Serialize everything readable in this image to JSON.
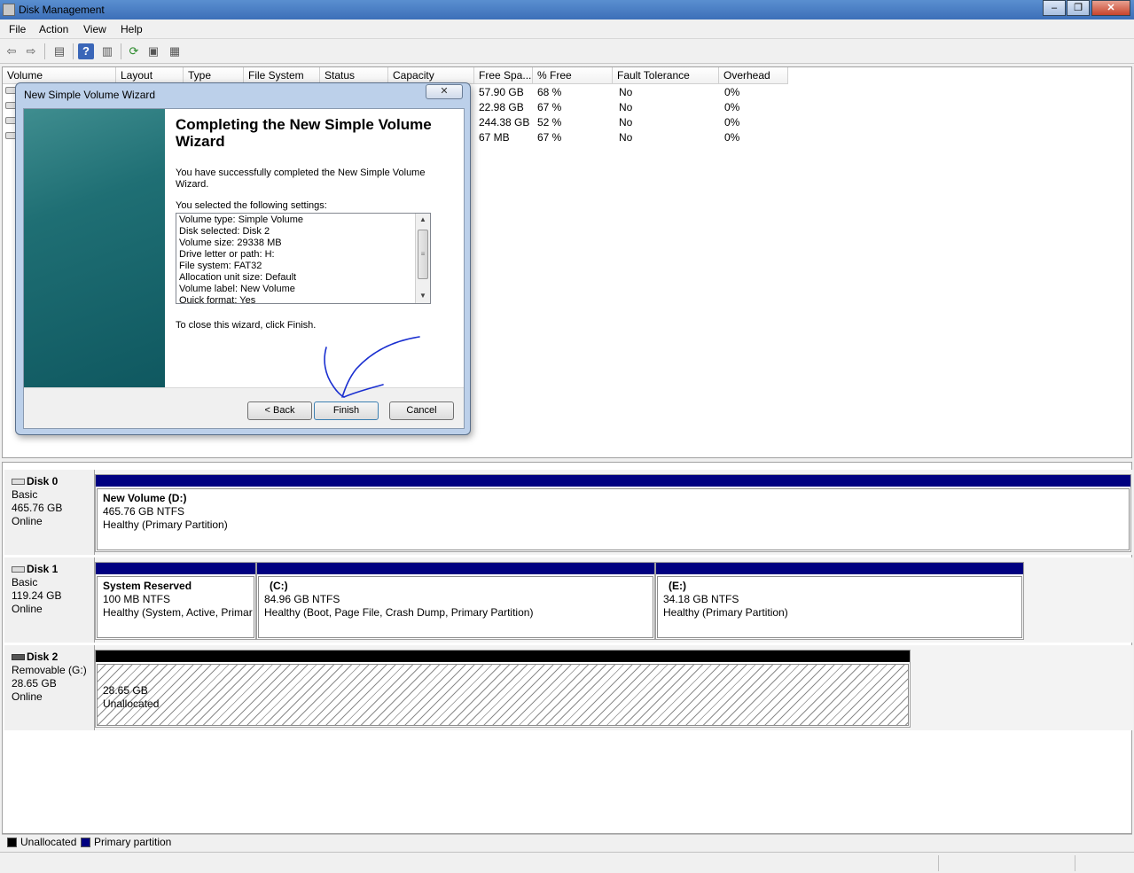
{
  "window": {
    "title": "Disk Management",
    "controls": {
      "minimize": "–",
      "restore": "❐",
      "close": "✕"
    }
  },
  "menu": [
    "File",
    "Action",
    "View",
    "Help"
  ],
  "toolbar": {
    "icons": [
      "back-icon",
      "forward-icon",
      "properties-icon",
      "help-icon",
      "show-hide-icon",
      "refresh-icon",
      "rescan-icon",
      "settings-icon"
    ]
  },
  "volume_table": {
    "columns": [
      "Volume",
      "Layout",
      "Type",
      "File System",
      "Status",
      "Capacity",
      "Free Spa...",
      "% Free",
      "Fault Tolerance",
      "Overhead"
    ],
    "rows": [
      {
        "free": "57.90 GB",
        "pct": "68 %",
        "fault": "No",
        "overhead": "0%"
      },
      {
        "free": "22.98 GB",
        "pct": "67 %",
        "fault": "No",
        "overhead": "0%"
      },
      {
        "free": "244.38 GB",
        "pct": "52 %",
        "fault": "No",
        "overhead": "0%"
      },
      {
        "free": "67 MB",
        "pct": "67 %",
        "fault": "No",
        "overhead": "0%"
      }
    ]
  },
  "disks": [
    {
      "name": "Disk 0",
      "type": "Basic",
      "size": "465.76 GB",
      "status": "Online",
      "partitions": [
        {
          "name": "New Volume  (D:)",
          "size": "465.76 GB NTFS",
          "status": "Healthy (Primary Partition)"
        }
      ]
    },
    {
      "name": "Disk 1",
      "type": "Basic",
      "size": "119.24 GB",
      "status": "Online",
      "partitions": [
        {
          "name": "System Reserved",
          "size": "100 MB NTFS",
          "status": "Healthy (System, Active, Primar"
        },
        {
          "name": "(C:)",
          "size": "84.96 GB NTFS",
          "status": "Healthy (Boot, Page File, Crash Dump, Primary Partition)"
        },
        {
          "name": "(E:)",
          "size": "34.18 GB NTFS",
          "status": "Healthy (Primary Partition)"
        }
      ]
    },
    {
      "name": "Disk 2",
      "type": "Removable (G:)",
      "size": "28.65 GB",
      "status": "Online",
      "partitions": [
        {
          "name": "",
          "size": "28.65 GB",
          "status": "Unallocated"
        }
      ]
    }
  ],
  "legend": [
    {
      "label": "Unallocated",
      "color": "#000000"
    },
    {
      "label": "Primary partition",
      "color": "#000080"
    }
  ],
  "wizard": {
    "title": "New Simple Volume Wizard",
    "close": "✕",
    "heading": "Completing the New Simple Volume Wizard",
    "intro": "You have successfully completed the New Simple Volume Wizard.",
    "settings_label": "You selected the following settings:",
    "settings": [
      "Volume type: Simple Volume",
      "Disk selected: Disk 2",
      "Volume size: 29338 MB",
      "Drive letter or path: H:",
      "File system: FAT32",
      "Allocation unit size: Default",
      "Volume label: New Volume",
      "Quick format: Yes"
    ],
    "close_hint": "To close this wizard, click Finish.",
    "buttons": {
      "back": "< Back",
      "finish": "Finish",
      "cancel": "Cancel"
    }
  },
  "colors": {
    "primary_partition": "#000080",
    "unallocated": "#000000",
    "annotation": "#1a2fd0"
  }
}
